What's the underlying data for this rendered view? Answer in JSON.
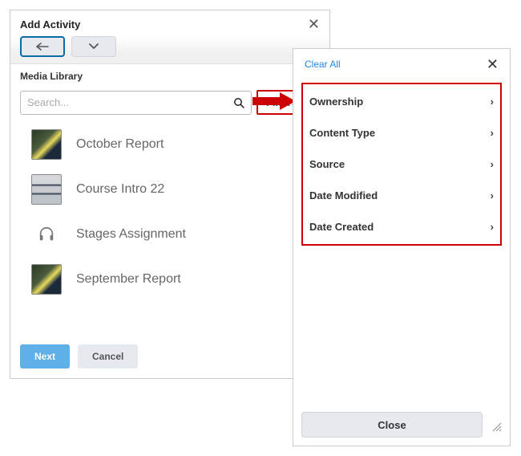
{
  "dialog": {
    "title": "Add Activity",
    "section_label": "Media Library",
    "search_placeholder": "Search...",
    "filters_label": "Filters",
    "next_label": "Next",
    "cancel_label": "Cancel"
  },
  "media_items": [
    {
      "title": "October Report",
      "thumb": "photo1"
    },
    {
      "title": "Course Intro 22",
      "thumb": "photo2"
    },
    {
      "title": "Stages Assignment",
      "thumb": "audio"
    },
    {
      "title": "September Report",
      "thumb": "photo1"
    }
  ],
  "filter_panel": {
    "clear_all": "Clear All",
    "close": "Close",
    "options": [
      "Ownership",
      "Content Type",
      "Source",
      "Date Modified",
      "Date Created"
    ]
  }
}
